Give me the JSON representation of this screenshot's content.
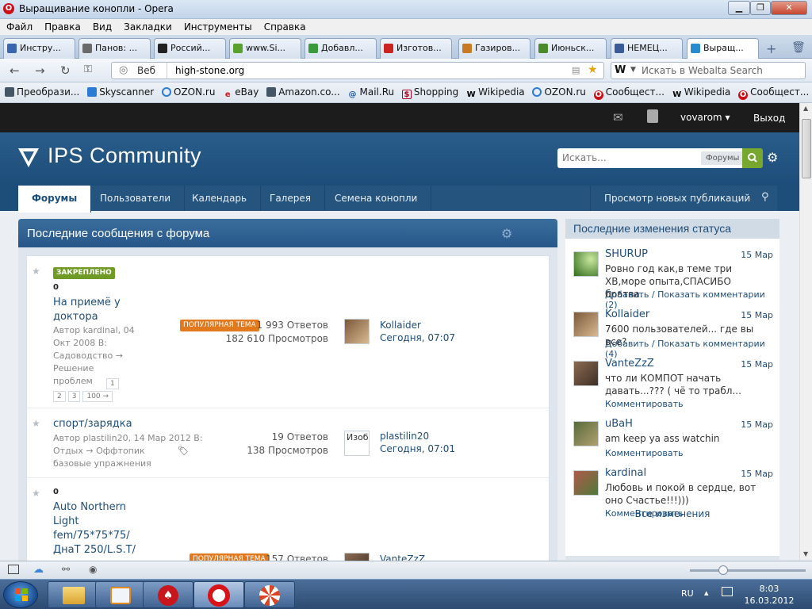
{
  "window": {
    "title": "Выращивание конопли - Opera"
  },
  "menu": [
    "Файл",
    "Правка",
    "Вид",
    "Закладки",
    "Инструменты",
    "Справка"
  ],
  "tabs": [
    {
      "label": "Инстру...",
      "color": "#3a66b0"
    },
    {
      "label": "Панов: ...",
      "color": "#6a6a6a"
    },
    {
      "label": "Россий...",
      "color": "#222222"
    },
    {
      "label": "www.Si...",
      "color": "#5aa02c"
    },
    {
      "label": "Добавл...",
      "color": "#3a9a3a"
    },
    {
      "label": "Изготов...",
      "color": "#cc2222"
    },
    {
      "label": "Газиров...",
      "color": "#c77a22"
    },
    {
      "label": "Июньск...",
      "color": "#4a8a2a"
    },
    {
      "label": "НЕМЕЦ...",
      "color": "#3b5b98"
    },
    {
      "label": "Выращ...",
      "color": "#2a8ad0"
    }
  ],
  "address": {
    "mode": "Веб",
    "url": "high-stone.org",
    "search_placeholder": "Искать в Webalta Search",
    "search_engine_icon": "W"
  },
  "bookmarks": [
    {
      "label": "Преобрази...",
      "icon": "star"
    },
    {
      "label": "Skyscanner",
      "icon": "plane"
    },
    {
      "label": "OZON.ru",
      "icon": "o"
    },
    {
      "label": "eBay",
      "icon": "ebay"
    },
    {
      "label": "Amazon.co...",
      "icon": "star"
    },
    {
      "label": "Mail.Ru",
      "icon": "at"
    },
    {
      "label": "Shopping",
      "icon": "bag"
    },
    {
      "label": "Wikipedia",
      "icon": "W"
    },
    {
      "label": "OZON.ru",
      "icon": "o"
    },
    {
      "label": "Сообщест...",
      "icon": "opera"
    },
    {
      "label": "Wikipedia",
      "icon": "W"
    },
    {
      "label": "Сообщест...",
      "icon": "opera"
    }
  ],
  "site": {
    "user": "vovarom",
    "logout": "Выход",
    "logo": "IPS Community",
    "search_placeholder": "Искать...",
    "search_scope": "Форумы",
    "nav": [
      "Форумы",
      "Пользователи",
      "Календарь",
      "Галерея",
      "Семена конопли"
    ],
    "nav_right": "Просмотр новых публикаций"
  },
  "main": {
    "heading": "Последние сообщения с форума",
    "topics": [
      {
        "pinned_label": "ЗАКРЕПЛЕНО",
        "marker": "0",
        "title_lines": [
          "На приемё у",
          "доктора"
        ],
        "meta_lines": [
          "Автор kardinal, 04",
          "Окт 2008 В:",
          "Садоводство →",
          "Решение",
          "проблем"
        ],
        "pages": [
          "1",
          "2",
          "3",
          "100 →"
        ],
        "hot_label": "ПОПУЛЯРНАЯ ТЕМА",
        "replies": "1 993 Ответов",
        "views": "182 610 Просмотров",
        "last_user": "Kollaider",
        "last_time": "Сегодня, 07:07"
      },
      {
        "title_lines": [
          "спорт/зарядка"
        ],
        "meta_lines": [
          "Автор plastilin20, 14 Мар 2012 В:",
          "Отдых → Оффтопик",
          "базовые упражнения"
        ],
        "replies": "19 Ответов",
        "views": "138 Просмотров",
        "avatar_alt": "Изоб",
        "last_user": "plastilin20",
        "last_time": "Сегодня, 07:01"
      },
      {
        "marker": "0",
        "title_lines": [
          "Auto Northern",
          "Light",
          "fem/75*75*75/",
          "ДнаТ 250/L.S.T/"
        ],
        "hot_label": "ПОПУЛЯРНАЯ ТЕМА",
        "replies": "157 Ответов",
        "last_user": "VanteZzZ"
      }
    ]
  },
  "sidebar": {
    "heading": "Последние изменения статуса",
    "statuses": [
      {
        "name": "SHURUP",
        "date": "15 Мар",
        "text": "Ровно год как,в теме три ХВ,море опыта,СПАСИБО братва.",
        "action": "Добавить / Показать комментарии (2)"
      },
      {
        "name": "Kollaider",
        "date": "15 Мар",
        "text": "7600 пользователей... где вы все?",
        "action": "Добавить / Показать комментарии (4)"
      },
      {
        "name": "VanteZzZ",
        "date": "15 Мар",
        "text": "что ли КОМПОТ начать давать...??? ( чё то трабл...",
        "action": "Комментировать"
      },
      {
        "name": "uBaH",
        "date": "15 Мар",
        "text": "am keep ya ass watchin",
        "action": "Комментировать"
      },
      {
        "name": "kardinal",
        "date": "15 Мар",
        "text": "Любовь и покой в сердце, вот оно Счастье!!!)))",
        "action": "Комментировать"
      }
    ],
    "all_changes": "Все изменения"
  },
  "taskbar": {
    "lang": "RU",
    "time": "8:03",
    "date": "16.03.2012"
  }
}
